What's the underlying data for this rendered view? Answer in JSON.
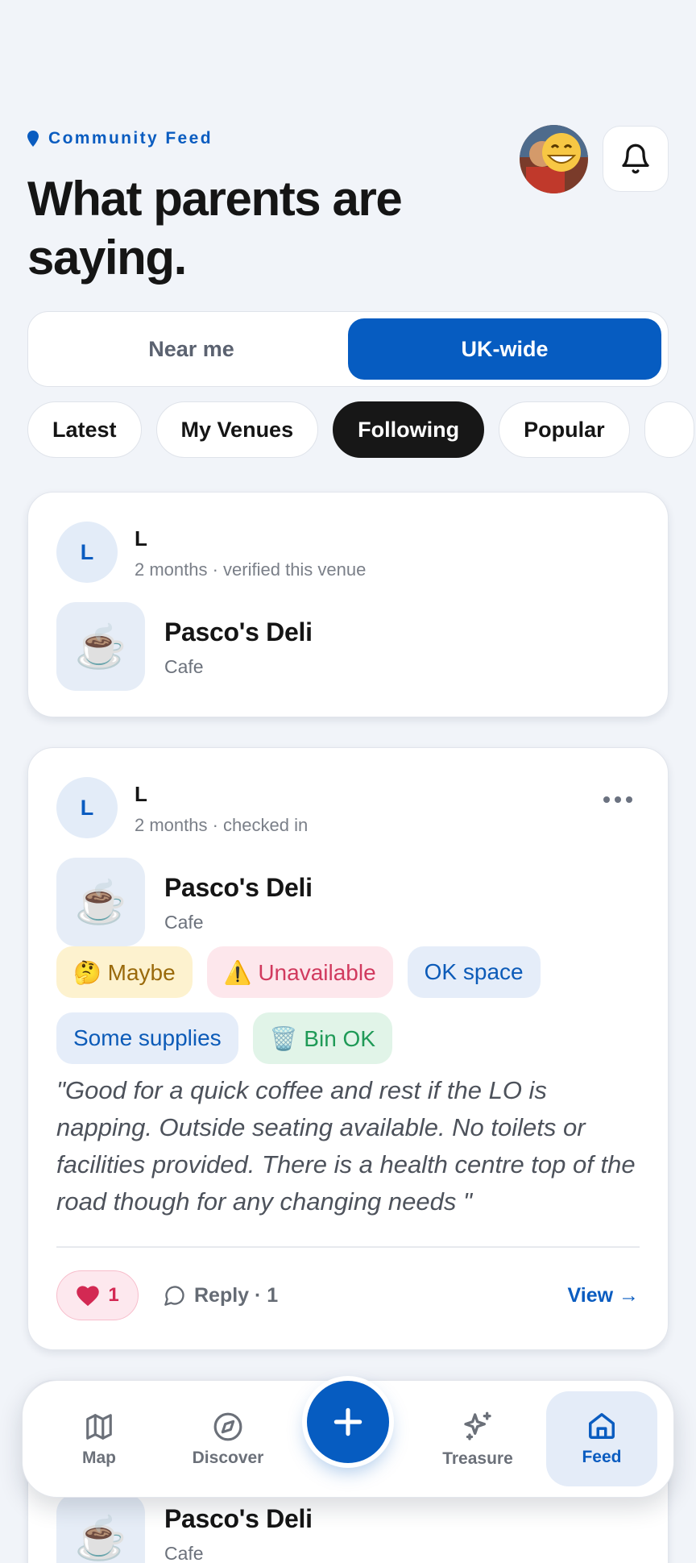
{
  "header": {
    "eyebrow": "Community Feed",
    "title": "What parents are saying."
  },
  "segment": {
    "options": [
      "Near me",
      "UK-wide"
    ],
    "selected": "UK-wide"
  },
  "filters": {
    "chips": [
      "Latest",
      "My Venues",
      "Following",
      "Popular",
      ""
    ],
    "selected": "Following"
  },
  "posts": [
    {
      "avatar_letter": "L",
      "user": "L",
      "meta": "2 months · verified this venue",
      "venue": {
        "icon": "☕",
        "name": "Pasco's Deli",
        "type": "Cafe"
      }
    },
    {
      "avatar_letter": "L",
      "user": "L",
      "meta": "2 months · checked in",
      "venue": {
        "icon": "☕",
        "name": "Pasco's Deli",
        "type": "Cafe"
      },
      "tags": [
        "🤔 Maybe",
        "⚠️ Unavailable",
        "OK space",
        "Some supplies",
        "🗑️ Bin OK"
      ],
      "quote": "\"Good for a quick coffee and rest if the LO is napping. Outside seating available. No toilets or facilities provided. There is a health centre top of the road though for any changing needs \"",
      "likes": "1",
      "reply_label": "Reply · 1",
      "view_label": "View →"
    },
    {
      "venue": {
        "icon": "☕",
        "name": "Pasco's Deli",
        "type": "Cafe"
      }
    }
  ],
  "nav": {
    "items": [
      "Map",
      "Discover",
      "Treasure",
      "Feed"
    ],
    "active": "Feed"
  },
  "colors": {
    "accent": "#065cc1",
    "background": "#f1f4f9",
    "like": "#d32953"
  }
}
